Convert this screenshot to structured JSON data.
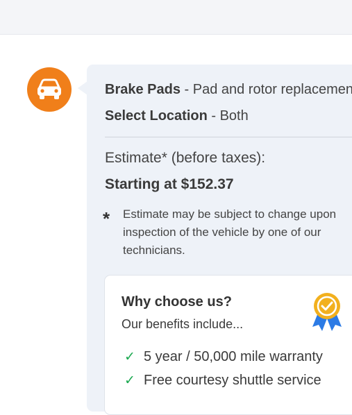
{
  "service": {
    "name": "Brake Pads",
    "description": " - Pad and rotor replacement",
    "location_label": "Select Location",
    "location_value": " - Both"
  },
  "estimate": {
    "label": "Estimate* (before taxes):",
    "price": "Starting at $152.37",
    "note_marker": "*",
    "note": "Estimate may be subject to change upon inspection of the vehicle by one of our technicians."
  },
  "benefits": {
    "title": "Why choose us?",
    "subtitle": "Our benefits include...",
    "items": [
      "5 year / 50,000 mile warranty",
      "Free courtesy shuttle service"
    ]
  },
  "colors": {
    "brand_orange": "#f07f1a",
    "check_green": "#1aa84f",
    "badge_gold": "#f2b01e",
    "badge_blue": "#2c7be5"
  },
  "icons": {
    "avatar": "car-icon",
    "badge": "award-ribbon-icon",
    "bullet": "checkmark-icon"
  }
}
